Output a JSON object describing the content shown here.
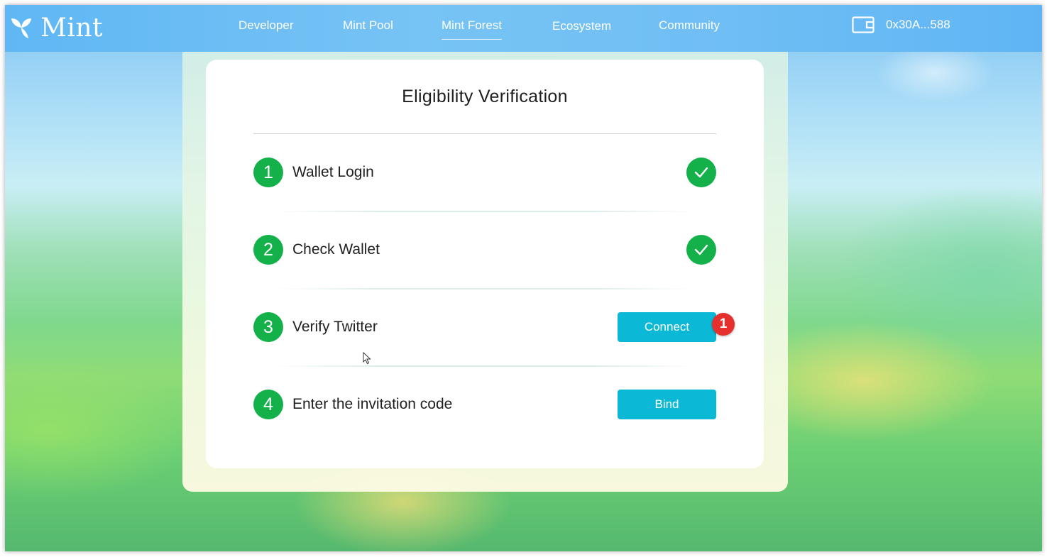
{
  "header": {
    "logo_text": "Mint",
    "nav": [
      "Developer",
      "Mint Pool",
      "Mint Forest",
      "Ecosystem",
      "Community"
    ],
    "active_nav": "Mint Forest",
    "wallet_address": "0x30A...588"
  },
  "card": {
    "title": "Eligibility Verification",
    "steps": [
      {
        "number": "1",
        "label": "Wallet Login",
        "status": "done"
      },
      {
        "number": "2",
        "label": "Check Wallet",
        "status": "done"
      },
      {
        "number": "3",
        "label": "Verify Twitter",
        "status": "action",
        "button_label": "Connect"
      },
      {
        "number": "4",
        "label": "Enter the invitation code",
        "status": "action",
        "button_label": "Bind"
      }
    ]
  },
  "annotation_badge": "1",
  "colors": {
    "topbar": "#6fbef4",
    "step_green": "#14b14a",
    "button_cyan": "#0bb9d6",
    "badge_red": "#e5302e"
  },
  "icons": {
    "logo": "mint-leaf-icon",
    "wallet": "wallet-icon",
    "check": "check-icon",
    "cursor": "mouse-pointer-icon"
  }
}
